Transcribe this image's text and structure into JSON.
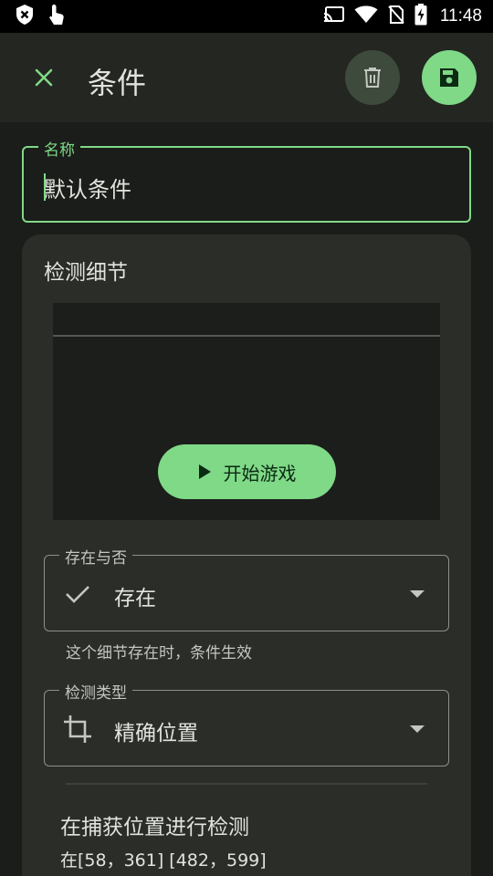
{
  "status_bar": {
    "time": "11:48",
    "icons": [
      "shield-x-icon",
      "touch-icon",
      "cast-icon",
      "wifi-icon",
      "no-sim-icon",
      "battery-charging-icon"
    ]
  },
  "app_bar": {
    "title": "条件",
    "close_icon": "close-icon",
    "delete_icon": "delete-icon",
    "save_icon": "save-icon"
  },
  "name_field": {
    "label": "名称",
    "value": "默认条件"
  },
  "detection_card": {
    "title": "检测细节",
    "start_button_label": "开始游戏",
    "presence": {
      "label": "存在与否",
      "value": "存在",
      "icon": "check-icon",
      "helper": "这个细节存在时，条件生效"
    },
    "detection_type": {
      "label": "检测类型",
      "value": "精确位置",
      "icon": "crop-icon"
    },
    "capture_section": {
      "title": "在捕获位置进行检测",
      "subtitle": "在[58，361] [482，599]"
    }
  },
  "colors": {
    "accent": "#7fd987",
    "background": "#1b1d1a",
    "app_bar": "#242622",
    "card": "#2a2d28"
  }
}
